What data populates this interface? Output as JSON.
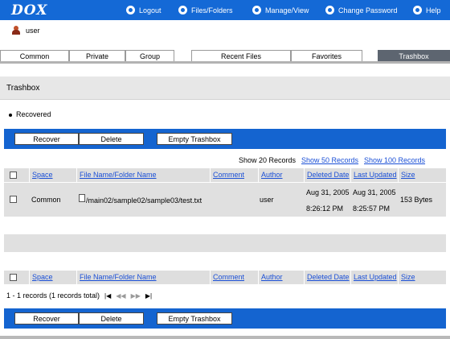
{
  "app": {
    "logo": "DOX"
  },
  "nav": {
    "logout": "Logout",
    "files_folders": "Files/Folders",
    "manage_view": "Manage/View",
    "change_password": "Change Password",
    "help": "Help"
  },
  "user": {
    "name": "user"
  },
  "tabs": {
    "common": "Common",
    "private": "Private",
    "group": "Group",
    "recent_files": "Recent Files",
    "favorites": "Favorites",
    "trashbox": "Trashbox"
  },
  "section": {
    "title": "Trashbox"
  },
  "message": "Recovered",
  "toolbar": {
    "recover": "Recover",
    "delete": "Delete",
    "empty": "Empty Trashbox"
  },
  "show": {
    "current": "Show 20 Records",
    "fifty": "Show 50 Records",
    "hundred": "Show 100 Records"
  },
  "columns": {
    "space": "Space",
    "file_name": "File Name/Folder Name",
    "comment": "Comment",
    "author": "Author",
    "deleted_date": "Deleted Date",
    "last_updated": "Last Updated",
    "size": "Size"
  },
  "rows": [
    {
      "space": "Common",
      "path": "/main02/sample02/sample03/test.txt",
      "comment": "",
      "author": "user",
      "deleted_date": "Aug 31, 2005",
      "deleted_time": "8:26:12 PM",
      "updated_date": "Aug 31, 2005",
      "updated_time": "8:25:57 PM",
      "size": "153 Bytes"
    }
  ],
  "pager": {
    "summary": "1 - 1 records (1 records total)",
    "first": "|◀",
    "prev": "◀◀",
    "next": "▶▶",
    "last": "▶|"
  },
  "colors": {
    "header_blue": "#1469d6",
    "toolbar_blue": "#1464d0",
    "tab_active": "#5d6570",
    "link": "#1a4fd6"
  }
}
